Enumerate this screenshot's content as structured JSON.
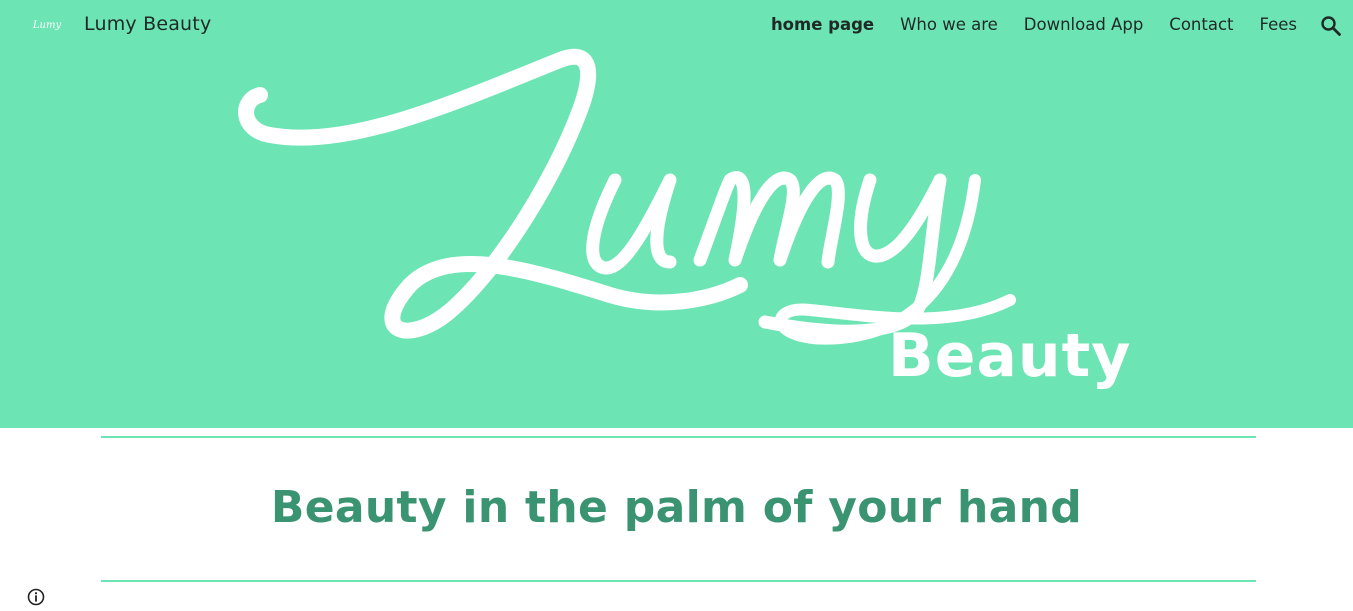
{
  "header": {
    "logo_small_text": "Lumy",
    "site_title": "Lumy Beauty"
  },
  "nav": {
    "items": [
      {
        "label": "home page",
        "active": true
      },
      {
        "label": "Who we are",
        "active": false
      },
      {
        "label": "Download App",
        "active": false
      },
      {
        "label": "Contact",
        "active": false
      },
      {
        "label": "Fees",
        "active": false
      }
    ],
    "search_icon": "search-icon"
  },
  "hero": {
    "logo_script_text": "Lumy",
    "logo_sub_text": "Beauty"
  },
  "main": {
    "tagline": "Beauty in the palm of your hand"
  },
  "footer": {
    "info_icon": "info-icon"
  },
  "colors": {
    "brand_mint": "#6ce4b4",
    "tagline_green": "#3a9471",
    "nav_text": "#1f2a26"
  }
}
